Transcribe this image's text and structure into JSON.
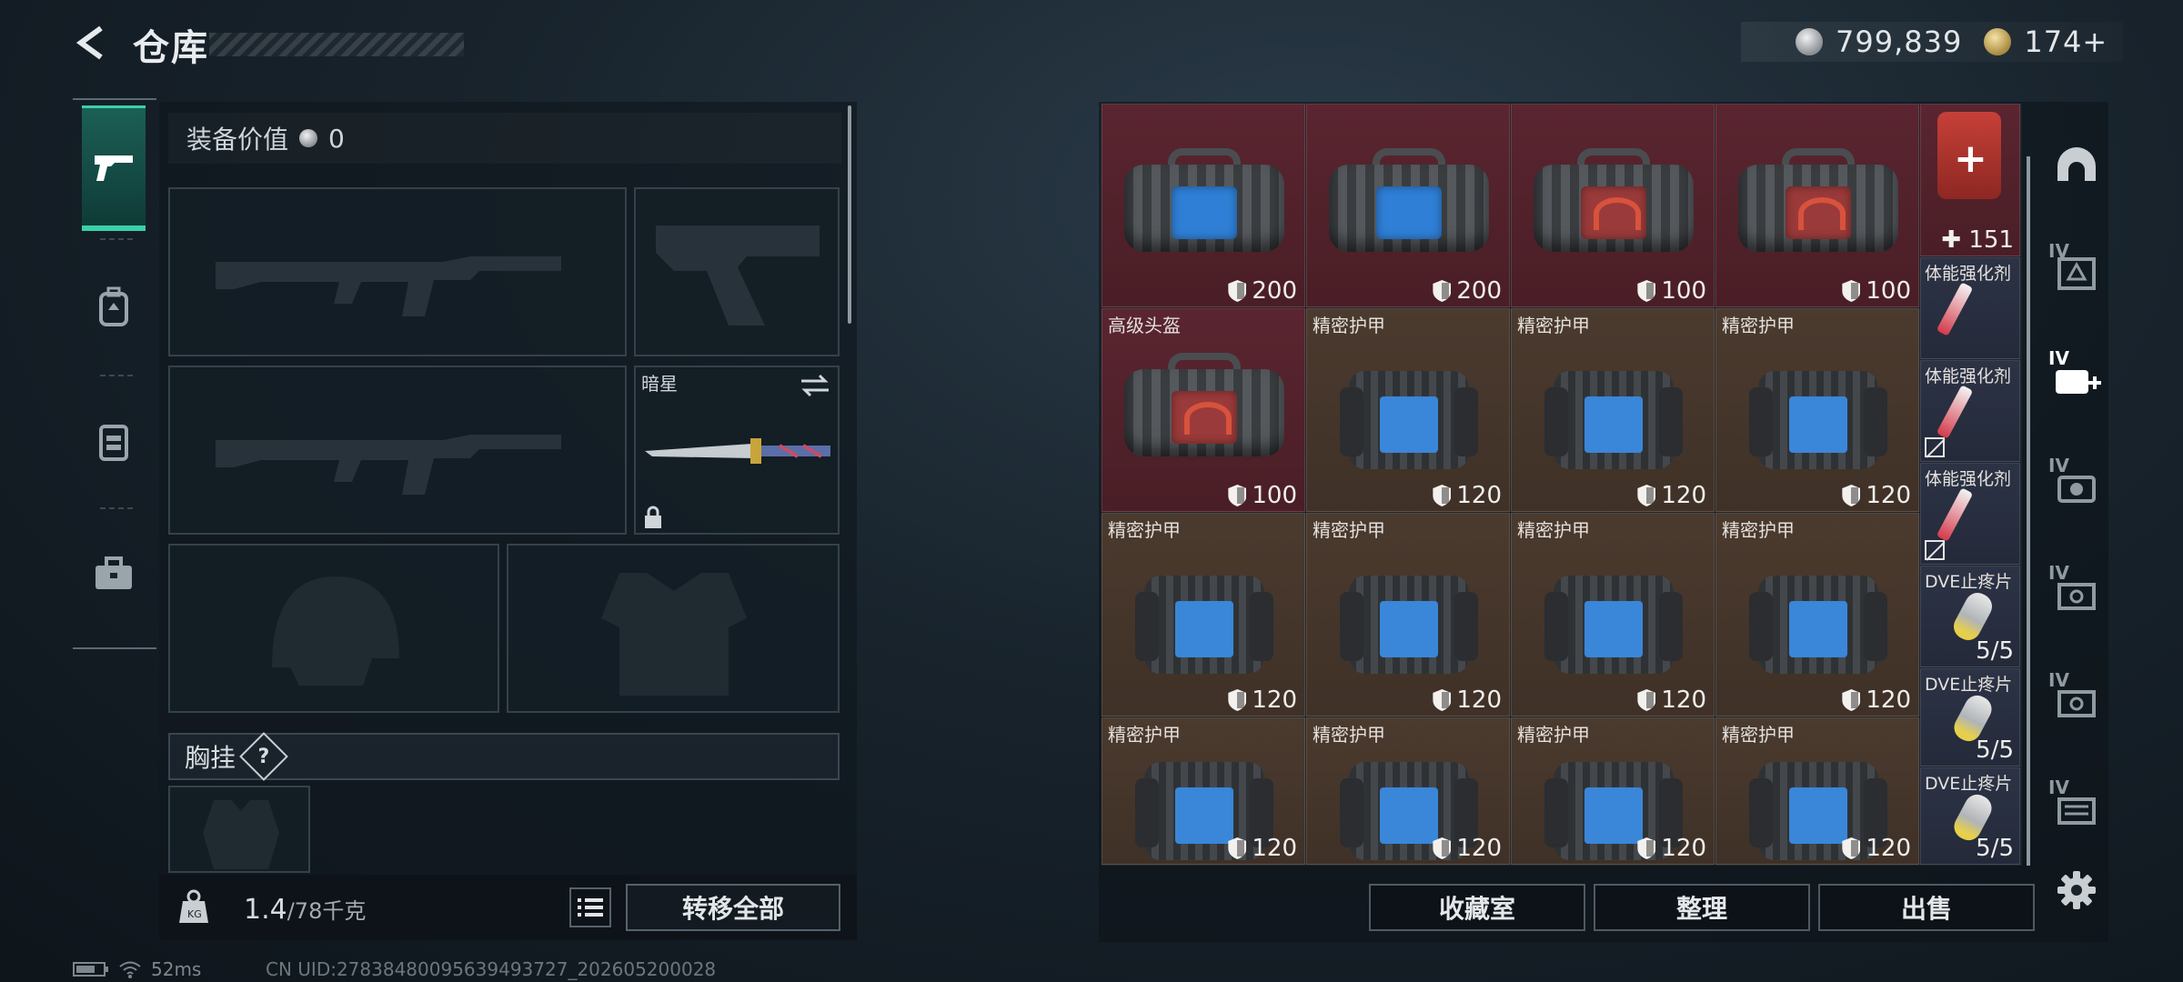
{
  "header": {
    "title": "仓库"
  },
  "currency": {
    "silver": "799,839",
    "gold": "174+"
  },
  "left_nav": [
    "pistol-icon",
    "backpack-icon",
    "rig-icon",
    "briefcase-icon"
  ],
  "equipment": {
    "value_label": "装备价值",
    "value": "0",
    "melee_label": "暗星",
    "chest_label": "胸挂",
    "chest_help": "?"
  },
  "weight": {
    "current": "1.4",
    "max": "/78千克"
  },
  "buttons": {
    "transfer_all": "转移全部",
    "collection": "收藏室",
    "organize": "整理",
    "sell": "出售"
  },
  "grid": {
    "row0": [
      {
        "label": "",
        "value": "200",
        "kind": "bag-blue"
      },
      {
        "label": "",
        "value": "200",
        "kind": "bag-blue"
      },
      {
        "label": "",
        "value": "100",
        "kind": "bag-red"
      },
      {
        "label": "",
        "value": "100",
        "kind": "bag-red"
      }
    ],
    "row1": [
      {
        "label": "高级头盔",
        "value": "100",
        "kind": "bag-red"
      },
      {
        "label": "精密护甲",
        "value": "120",
        "kind": "vest"
      },
      {
        "label": "精密护甲",
        "value": "120",
        "kind": "vest"
      },
      {
        "label": "精密护甲",
        "value": "120",
        "kind": "vest"
      }
    ],
    "row2": [
      {
        "label": "精密护甲",
        "value": "120"
      },
      {
        "label": "精密护甲",
        "value": "120"
      },
      {
        "label": "精密护甲",
        "value": "120"
      },
      {
        "label": "精密护甲",
        "value": "120"
      }
    ],
    "row3": [
      {
        "label": "精密护甲",
        "value": "120"
      },
      {
        "label": "精密护甲",
        "value": "120"
      },
      {
        "label": "精密护甲",
        "value": "120"
      },
      {
        "label": "精密护甲",
        "value": "120"
      }
    ],
    "side": [
      {
        "label": "",
        "value": "151",
        "icon": "medkit"
      },
      {
        "label": "体能强化剂",
        "value": "",
        "icon": "syringe"
      },
      {
        "label": "体能强化剂",
        "value": "",
        "icon": "syringe"
      },
      {
        "label": "体能强化剂",
        "value": "",
        "icon": "syringe"
      },
      {
        "label": "DVE止疼片",
        "value": "5/5",
        "icon": "pill"
      },
      {
        "label": "DVE止疼片",
        "value": "5/5",
        "icon": "pill"
      },
      {
        "label": "DVE止疼片",
        "value": "5/5",
        "icon": "pill"
      }
    ]
  },
  "right_side_icons": [
    {
      "tier": "",
      "icon": "helmet-icon"
    },
    {
      "tier": "IV",
      "icon": "chest-rig-icon"
    },
    {
      "tier": "IV",
      "icon": "medical-add-icon"
    },
    {
      "tier": "IV",
      "icon": "camera-icon"
    },
    {
      "tier": "IV",
      "icon": "gear-box-icon"
    },
    {
      "tier": "IV",
      "icon": "gear-box-icon"
    },
    {
      "tier": "IV",
      "icon": "case-icon"
    }
  ],
  "status": {
    "ping": "52ms",
    "uid": "CN UID:278384800956394937​27_202605200028"
  }
}
